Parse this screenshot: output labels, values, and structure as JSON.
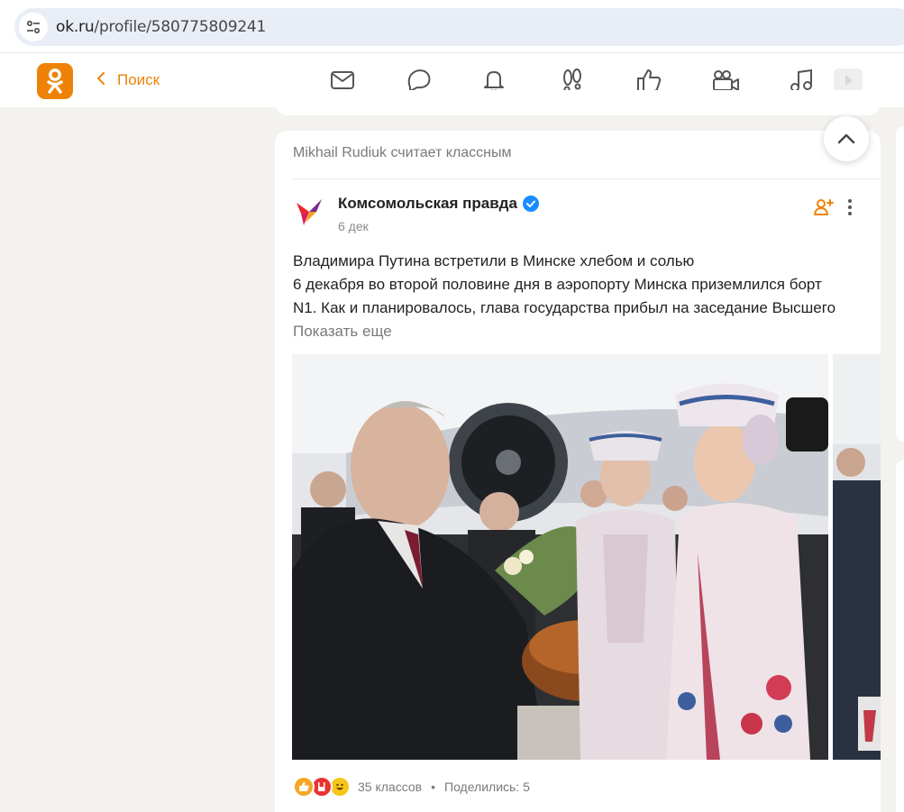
{
  "browser": {
    "url_host": "ok.ru",
    "url_path": "/profile/580775809241"
  },
  "header": {
    "back_label": "Поиск",
    "nav_icons": [
      "mail-icon",
      "chat-icon",
      "bell-icon",
      "guests-icon",
      "like-icon",
      "video-camera-icon",
      "music-icon",
      "video-play-icon"
    ]
  },
  "feed": {
    "liked_by": "Mikhail Rudiuk считает классным",
    "post": {
      "publisher": "Комсомольская правда",
      "date": "6 дек",
      "title": "Владимира Путина встретили в Минске хлебом и солью",
      "body_line1": "6 декабря во второй половине дня в аэропорту Минска приземлился борт",
      "body_line2": "N1. Как и планировалось, глава государства прибыл на заседание Высшего",
      "show_more": "Показать еще",
      "reactions_count": "35 классов",
      "separator": "•",
      "shares": "Поделились: 5"
    }
  },
  "colors": {
    "brand": "#ee8208",
    "verified": "#1a8cff",
    "background": "#f4f2ef"
  }
}
